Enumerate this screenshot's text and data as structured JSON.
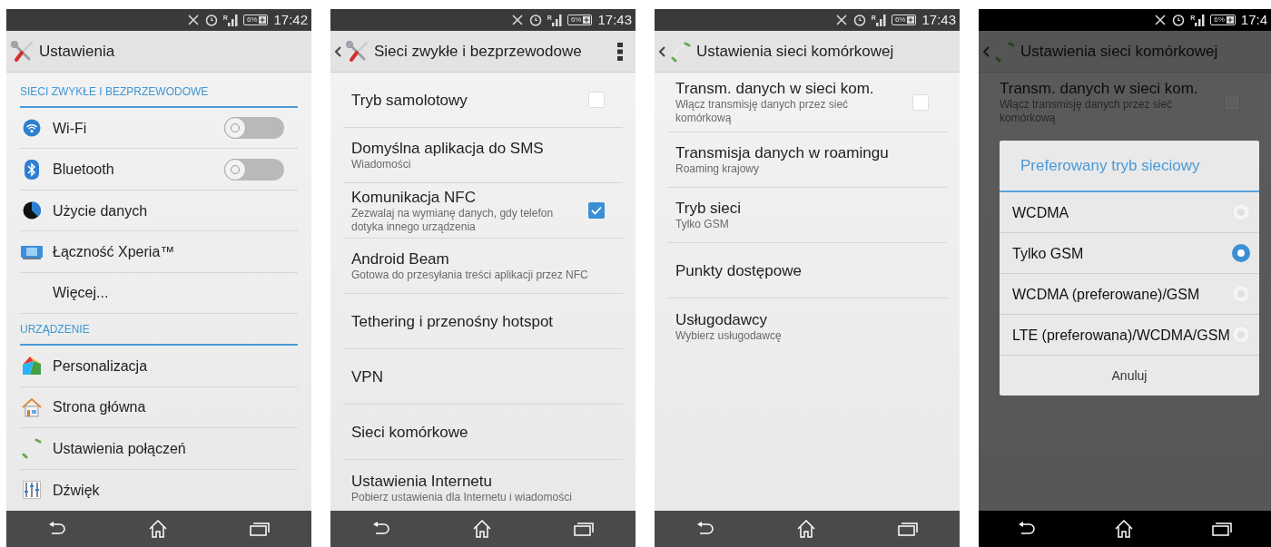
{
  "phones": [
    {
      "status": {
        "signal_mark": "R",
        "battery": "6%",
        "time": "17:42"
      },
      "dimmed": false,
      "header": {
        "title": "Ustawienia",
        "back": false,
        "overflow_menu": false
      },
      "items": [
        {
          "kind": "section",
          "label": "SIECI ZWYKŁE I BEZPRZEWODOWE"
        },
        {
          "kind": "toggle",
          "title": "Wi-Fi",
          "on": false
        },
        {
          "kind": "toggle",
          "title": "Bluetooth",
          "on": false
        },
        {
          "kind": "item",
          "title": "Użycie danych"
        },
        {
          "kind": "item",
          "title": "Łączność Xperia™"
        },
        {
          "kind": "item",
          "title": "Więcej..."
        },
        {
          "kind": "section",
          "label": "URZĄDZENIE"
        },
        {
          "kind": "item",
          "title": "Personalizacja"
        },
        {
          "kind": "item",
          "title": "Strona główna"
        },
        {
          "kind": "item",
          "title": "Ustawienia połączeń"
        },
        {
          "kind": "item",
          "title": "Dźwięk"
        }
      ]
    },
    {
      "status": {
        "signal_mark": "R",
        "battery": "6%",
        "time": "17:43"
      },
      "dimmed": false,
      "header": {
        "title": "Sieci zwykłe i bezprzewodowe",
        "back": true,
        "overflow_menu": true
      },
      "items": [
        {
          "kind": "checkbox",
          "title": "Tryb samolotowy",
          "checked": false
        },
        {
          "kind": "item",
          "title": "Domyślna aplikacja do SMS",
          "subtitle": "Wiadomości"
        },
        {
          "kind": "checkbox",
          "title": "Komunikacja NFC",
          "subtitle": "Zezwalaj na wymianę danych, gdy telefon dotyka innego urządzenia",
          "checked": true
        },
        {
          "kind": "item",
          "title": "Android Beam",
          "subtitle": "Gotowa do przesyłania treści aplikacji przez NFC"
        },
        {
          "kind": "item",
          "title": "Tethering i przenośny hotspot"
        },
        {
          "kind": "item",
          "title": "VPN"
        },
        {
          "kind": "item",
          "title": "Sieci komórkowe"
        },
        {
          "kind": "item",
          "title": "Ustawienia Internetu",
          "subtitle": "Pobierz ustawienia dla Internetu i wiadomości"
        }
      ]
    },
    {
      "status": {
        "signal_mark": "R",
        "battery": "6%",
        "time": "17:43"
      },
      "dimmed": false,
      "header": {
        "title": "Ustawienia sieci komórkowej",
        "back": true,
        "overflow_menu": false
      },
      "items": [
        {
          "kind": "checkbox",
          "title": "Transm. danych w sieci kom.",
          "subtitle": "Włącz transmisję danych przez sieć komórkową",
          "checked": false
        },
        {
          "kind": "item",
          "title": "Transmisja danych w roamingu",
          "subtitle": "Roaming krajowy"
        },
        {
          "kind": "item",
          "title": "Tryb sieci",
          "subtitle": "Tylko GSM"
        },
        {
          "kind": "item",
          "title": "Punkty dostępowe"
        },
        {
          "kind": "item",
          "title": "Usługodawcy",
          "subtitle": "Wybierz usługodawcę"
        }
      ]
    },
    {
      "status": {
        "signal_mark": "R",
        "battery": "6%",
        "time": "17:4"
      },
      "dimmed": true,
      "header": {
        "title": "Ustawienia sieci komórkowej",
        "back": true,
        "overflow_menu": false
      },
      "items": [
        {
          "kind": "checkbox",
          "title": "Transm. danych w sieci kom.",
          "subtitle": "Włącz transmisję danych przez sieć komórkową",
          "checked": false
        }
      ],
      "dialog": {
        "title": "Preferowany tryb sieciowy",
        "options": [
          {
            "label": "WCDMA",
            "selected": false
          },
          {
            "label": "Tylko GSM",
            "selected": true
          },
          {
            "label": "WCDMA (preferowane)/GSM",
            "selected": false
          },
          {
            "label": "LTE (preferowana)/WCDMA/GSM",
            "selected": false
          }
        ],
        "cancel": "Anuluj"
      }
    }
  ]
}
